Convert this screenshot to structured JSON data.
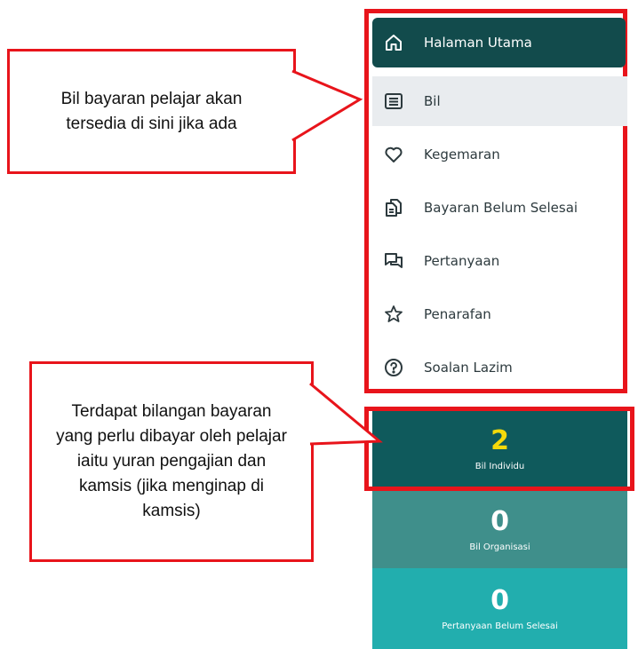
{
  "sidebar": {
    "items": [
      {
        "label": "Halaman Utama",
        "icon": "home-icon"
      },
      {
        "label": "Bil",
        "icon": "list-icon"
      },
      {
        "label": "Kegemaran",
        "icon": "heart-icon"
      },
      {
        "label": "Bayaran Belum Selesai",
        "icon": "document-icon"
      },
      {
        "label": "Pertanyaan",
        "icon": "chat-icon"
      },
      {
        "label": "Penarafan",
        "icon": "star-icon"
      },
      {
        "label": "Soalan Lazim",
        "icon": "help-icon"
      }
    ]
  },
  "tiles": [
    {
      "value": "2",
      "label": "Bil Individu",
      "bg": "#0f5a5c",
      "value_color": "#f5d90a"
    },
    {
      "value": "0",
      "label": "Bil Organisasi",
      "bg": "#3f8f8b",
      "value_color": "#ffffff"
    },
    {
      "value": "0",
      "label": "Pertanyaan Belum Selesai",
      "bg": "#22aeae",
      "value_color": "#ffffff"
    }
  ],
  "callouts": {
    "top": "Bil bayaran pelajar akan tersedia di sini jika ada",
    "bottom": "Terdapat bilangan bayaran yang perlu dibayar oleh pelajar iaitu yuran pengajian dan kamsis (jika menginap di kamsis)"
  },
  "colors": {
    "accent_red": "#e8141b",
    "active_bg": "#124b4c"
  }
}
